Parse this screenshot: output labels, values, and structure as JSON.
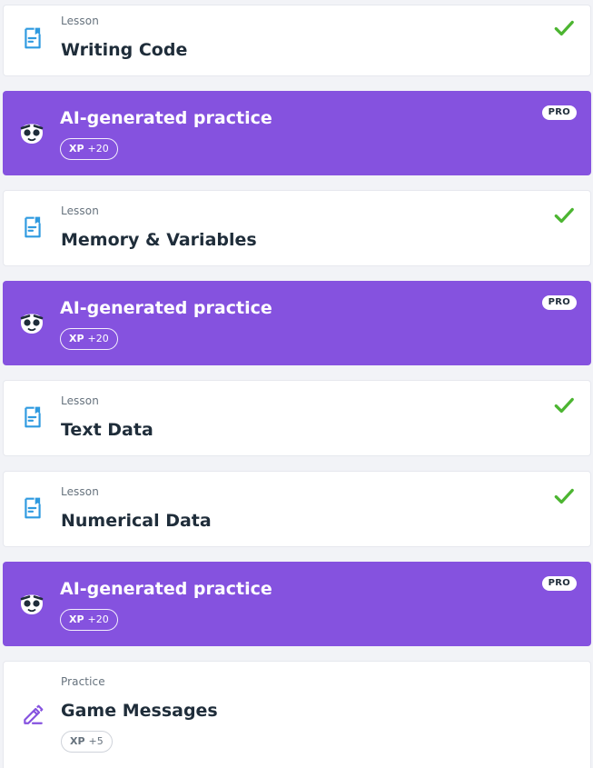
{
  "colors": {
    "background": "#f2f3f7",
    "ai_card": "#8552df",
    "lesson_icon": "#2f9ae0",
    "practice_icon": "#8552df",
    "check": "#4cb531",
    "title_text": "#1f2d3a",
    "kicker_text": "#66727d"
  },
  "items": [
    {
      "type": "lesson",
      "kicker": "Lesson",
      "title": "Writing Code",
      "icon": "document-icon",
      "completed": true
    },
    {
      "type": "ai-practice",
      "title": "AI-generated practice",
      "badge": "PRO",
      "xp_label": "XP",
      "xp_value": "+20",
      "icon": "ai-mascot-icon"
    },
    {
      "type": "lesson",
      "kicker": "Lesson",
      "title": "Memory & Variables",
      "icon": "document-icon",
      "completed": true
    },
    {
      "type": "ai-practice",
      "title": "AI-generated practice",
      "badge": "PRO",
      "xp_label": "XP",
      "xp_value": "+20",
      "icon": "ai-mascot-icon"
    },
    {
      "type": "lesson",
      "kicker": "Lesson",
      "title": "Text Data",
      "icon": "document-icon",
      "completed": true
    },
    {
      "type": "lesson",
      "kicker": "Lesson",
      "title": "Numerical Data",
      "icon": "document-icon",
      "completed": true
    },
    {
      "type": "ai-practice",
      "title": "AI-generated practice",
      "badge": "PRO",
      "xp_label": "XP",
      "xp_value": "+20",
      "icon": "ai-mascot-icon"
    },
    {
      "type": "practice",
      "kicker": "Practice",
      "title": "Game Messages",
      "xp_label": "XP",
      "xp_value": "+5",
      "icon": "pencil-icon",
      "completed": false
    }
  ]
}
